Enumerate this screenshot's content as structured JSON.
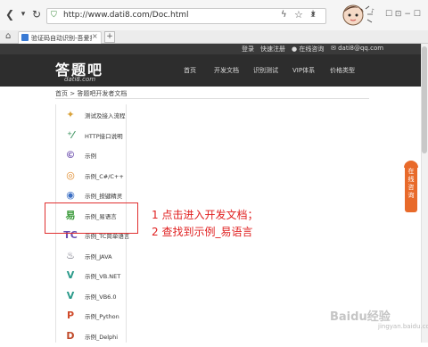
{
  "browser": {
    "url": "http://www.dati8.com/Doc.html",
    "tab_label": "验证码自动识别-吾爱打卡...",
    "new_tab": "+",
    "close_tab": "×",
    "back_icon": "back-arrow",
    "forward_icon": "forward-arrow",
    "reload_icon": "reload"
  },
  "site_bar": {
    "login": "登录",
    "register": "快速注册",
    "online": "在线咨询",
    "email": "dati8@qq.com"
  },
  "nav": {
    "logo": "答题吧",
    "logo_sub": "dati8.com",
    "items": [
      "首页",
      "开发文档",
      "识别测试",
      "VIP体系",
      "价格类型"
    ]
  },
  "breadcrumb": "首页 > 答题吧开发者文档",
  "sidebar": [
    {
      "label": "测试及接入流程",
      "icon": "✦",
      "color": "#d9a23a"
    },
    {
      "label": "HTTP接口说明",
      "icon": "⁺⁄",
      "color": "#4a9a6a"
    },
    {
      "label": "示例",
      "icon": "©",
      "color": "#7a5fb5"
    },
    {
      "label": "示例_C#/C++",
      "icon": "◎",
      "color": "#e08a2a"
    },
    {
      "label": "示例_按键精灵",
      "icon": "◉",
      "color": "#3b6fc4"
    },
    {
      "label": "示例_易语言",
      "icon": "易",
      "color": "#3a9a3a"
    },
    {
      "label": "示例_TC简单语言",
      "icon": "TC",
      "color": "#6a4fb0"
    },
    {
      "label": "示例_JAVA",
      "icon": "♨",
      "color": "#556"
    },
    {
      "label": "示例_VB.NET",
      "icon": "V",
      "color": "#2a9a8a"
    },
    {
      "label": "示例_VB6.0",
      "icon": "V",
      "color": "#2a9a8a"
    },
    {
      "label": "示例_Python",
      "icon": "P",
      "color": "#d04a2a"
    },
    {
      "label": "示例_Delphi",
      "icon": "D",
      "color": "#c04a2a"
    }
  ],
  "annotation": {
    "line1": "1 点击进入开发文档；",
    "line2": "2 查找到示例_易语言"
  },
  "float_button": "在线咨询",
  "watermark": "Baidu经验",
  "watermark_sub": "jingyan.baidu.com",
  "colors": {
    "accent_red": "#e02020",
    "nav_bg": "#2d2d2d",
    "float_orange": "#e86a2a"
  }
}
